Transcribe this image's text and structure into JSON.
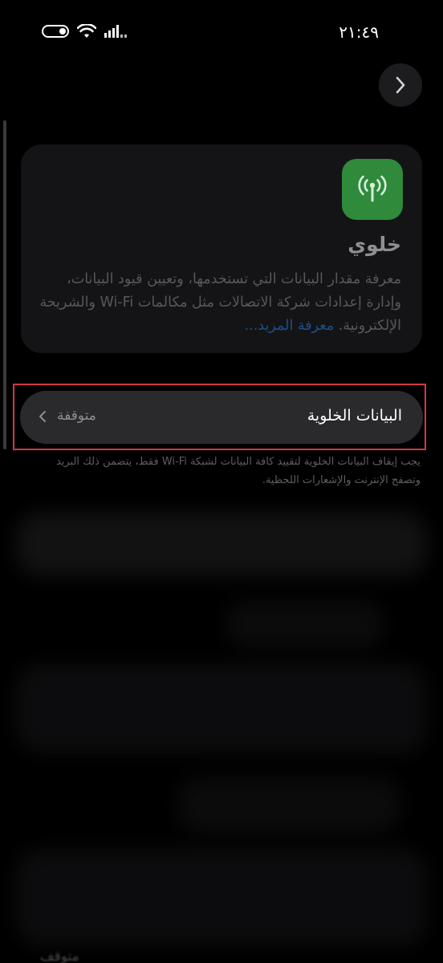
{
  "status_bar": {
    "time": "٢١:٤٩",
    "icons": [
      "battery-icon",
      "wifi-icon",
      "signal-icon"
    ]
  },
  "nav": {
    "icon": "chevron-right-icon"
  },
  "header_card": {
    "icon": "cellular-antenna-icon",
    "icon_color": "#2f8a3c",
    "title": "خلوي",
    "description": "معرفة مقدار البيانات التي تستخدمها، وتعيين قيود البيانات، وإدارة إعدادات شركة الاتصالات مثل مكالمات Wi-Fi والشريحة الإلكترونية.",
    "learn_more": "معرفة المزيد..."
  },
  "cellular_data_row": {
    "label": "البيانات الخلوية",
    "value": "متوقفة",
    "chevron": "chevron-left-icon"
  },
  "footnote": "يجب إيقاف البيانات الخلوية لتقييد كافة البيانات لشبكة Wi-Fi فقط، يتضمن ذلك البريد وتصفح الإنترنت والإشعارات اللحظية.",
  "bottom_ghost_text": "متوقف",
  "colors": {
    "highlight": "#d23a3f",
    "link": "#1c4f8a",
    "background": "#000000"
  }
}
